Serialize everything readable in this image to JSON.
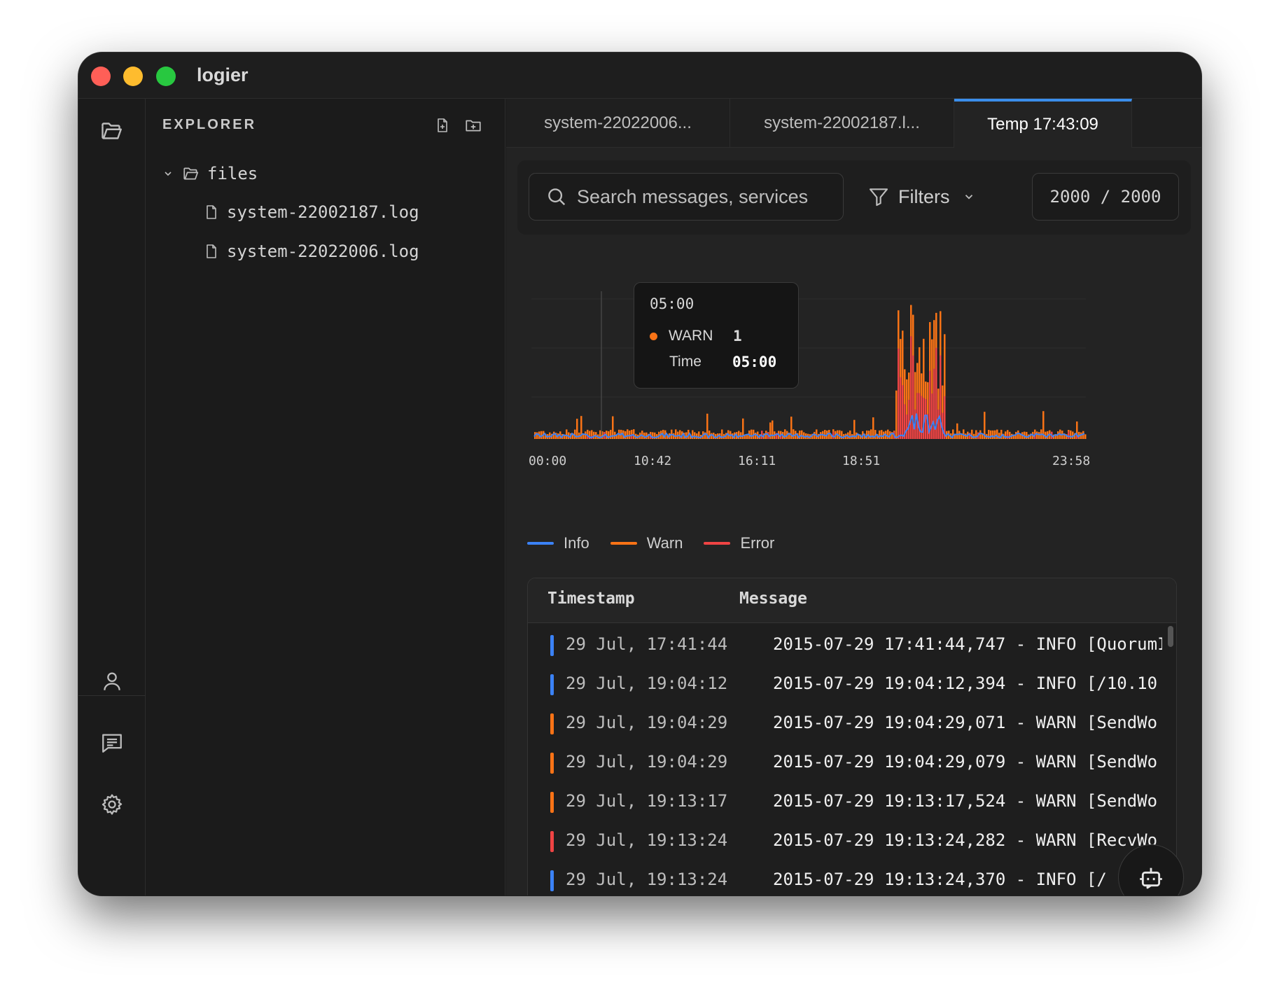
{
  "window": {
    "app_title": "logier"
  },
  "activity_bar": {
    "top_icons": [
      "folder-open-icon"
    ],
    "bottom_icons": [
      "user-icon",
      "message-icon",
      "gear-icon"
    ]
  },
  "explorer": {
    "title": "EXPLORER",
    "actions": [
      "new-file-icon",
      "new-folder-icon"
    ],
    "folder": {
      "name": "files"
    },
    "files": [
      {
        "name": "system-22002187.log"
      },
      {
        "name": "system-22022006.log"
      }
    ]
  },
  "tabs": [
    {
      "label": "system-22022006..."
    },
    {
      "label": "system-22002187.l..."
    },
    {
      "label": "Temp 17:43:09",
      "active": true
    }
  ],
  "toolbar": {
    "search_placeholder": "Search messages, services",
    "filters_label": "Filters",
    "counter": "2000 / 2000"
  },
  "chart": {
    "x_ticks": [
      "00:00",
      "10:42",
      "16:11",
      "18:51",
      "23:58"
    ],
    "tooltip": {
      "time": "05:00",
      "series": "WARN",
      "count": "1",
      "time_label": "Time",
      "time_value": "05:00"
    },
    "legend": [
      {
        "name": "Info",
        "color": "#3b82f6"
      },
      {
        "name": "Warn",
        "color": "#f97316"
      },
      {
        "name": "Error",
        "color": "#ef4444"
      }
    ]
  },
  "chart_data": {
    "type": "bar",
    "x_ticks": [
      "00:00",
      "10:42",
      "16:11",
      "18:51",
      "23:58"
    ],
    "series": [
      {
        "name": "Info",
        "color": "#3b82f6"
      },
      {
        "name": "Warn",
        "color": "#f97316"
      },
      {
        "name": "Error",
        "color": "#ef4444"
      }
    ],
    "legend_position": "bottom-left",
    "grid": true
  },
  "table": {
    "headers": {
      "timestamp": "Timestamp",
      "message": "Message"
    },
    "rows": [
      {
        "level": "info",
        "color": "#3b82f6",
        "timestamp": "29 Jul, 17:41:44",
        "message": "2015-07-29 17:41:44,747 - INFO [QuorumI"
      },
      {
        "level": "info",
        "color": "#3b82f6",
        "timestamp": "29 Jul, 19:04:12",
        "message": "2015-07-29 19:04:12,394 - INFO [/10.10"
      },
      {
        "level": "warn",
        "color": "#f97316",
        "timestamp": "29 Jul, 19:04:29",
        "message": "2015-07-29 19:04:29,071 - WARN [SendWo"
      },
      {
        "level": "warn",
        "color": "#f97316",
        "timestamp": "29 Jul, 19:04:29",
        "message": "2015-07-29 19:04:29,079 - WARN [SendWo"
      },
      {
        "level": "warn",
        "color": "#f97316",
        "timestamp": "29 Jul, 19:13:17",
        "message": "2015-07-29 19:13:17,524 - WARN [SendWo"
      },
      {
        "level": "error",
        "color": "#ef4444",
        "timestamp": "29 Jul, 19:13:24",
        "message": "2015-07-29 19:13:24,282 - WARN [RecvWo"
      },
      {
        "level": "info",
        "color": "#3b82f6",
        "timestamp": "29 Jul, 19:13:24",
        "message": "2015-07-29 19:13:24,370 - INFO [/"
      }
    ]
  },
  "assistant_button": {
    "icon": "bot-icon"
  }
}
